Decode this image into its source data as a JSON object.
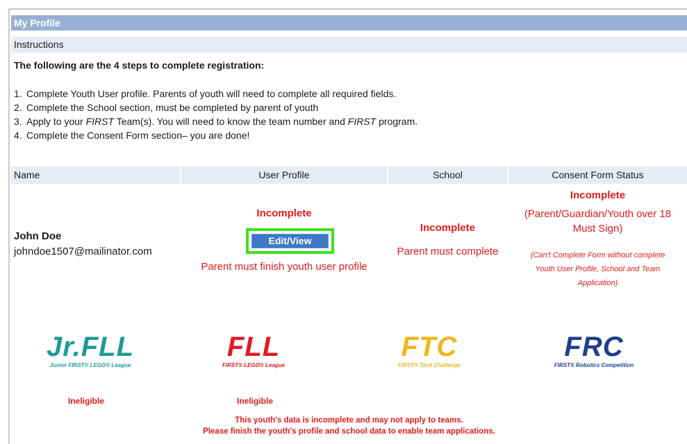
{
  "page": {
    "title": "My Profile",
    "instructions_label": "Instructions",
    "steps_heading": "The following are the 4 steps to complete registration:",
    "steps": [
      {
        "num": "1.",
        "text": "Complete Youth User profile. Parents of youth will need to complete all required fields."
      },
      {
        "num": "2.",
        "text": "Complete the School section, must be completed by parent of youth"
      },
      {
        "num": "3.",
        "pre": "Apply to your ",
        "em1": "FIRST",
        "mid": " Team(s). You will need to know the team number and ",
        "em2": "FIRST",
        "post": " program."
      },
      {
        "num": "4.",
        "text": "Complete the Consent Form section– you are done!"
      }
    ]
  },
  "table": {
    "headers": {
      "name": "Name",
      "user_profile": "User Profile",
      "school": "School",
      "consent": "Consent Form Status"
    },
    "row": {
      "name": "John Doe",
      "email": "johndoe1507@mailinator.com",
      "profile_status": "Incomplete",
      "edit_button": "Edit/View",
      "profile_note": "Parent must finish youth user profile",
      "school_status": "Incomplete",
      "school_note": "Parent must complete",
      "consent_status": "Incomplete",
      "consent_sub_1": "(Parent/Guardian/Youth over 18",
      "consent_sub_2": "Must Sign)",
      "consent_note_1": "(Can't Complete Form without complete",
      "consent_note_2": "Youth User Profile, School and Team",
      "consent_note_3": "Application)"
    }
  },
  "programs": [
    {
      "mark": "Jr.FLL",
      "tag": "Junior FIRST® LEGO® League",
      "eligibility": "Ineligible",
      "color": "#1f9a97"
    },
    {
      "mark": "FLL",
      "tag": "FIRST® LEGO® League",
      "eligibility": "Ineligible",
      "color": "#e01b24"
    },
    {
      "mark": "FTC",
      "tag": "FIRST® Tech Challenge",
      "color": "#f2b61b"
    },
    {
      "mark": "FRC",
      "tag": "FIRST® Robotics Competition",
      "color": "#1e3f8c"
    }
  ],
  "footer": {
    "line1": "This youth's data is incomplete and may not apply to teams.",
    "line2": "Please finish the youth's profile and school data to enable team applications."
  },
  "colors": {
    "header_bar": "#99b0d6",
    "row_header": "#e5ecf6",
    "error_red": "#e01b1b",
    "button_blue": "#3f78c6",
    "highlight_green": "#3ee21b"
  }
}
